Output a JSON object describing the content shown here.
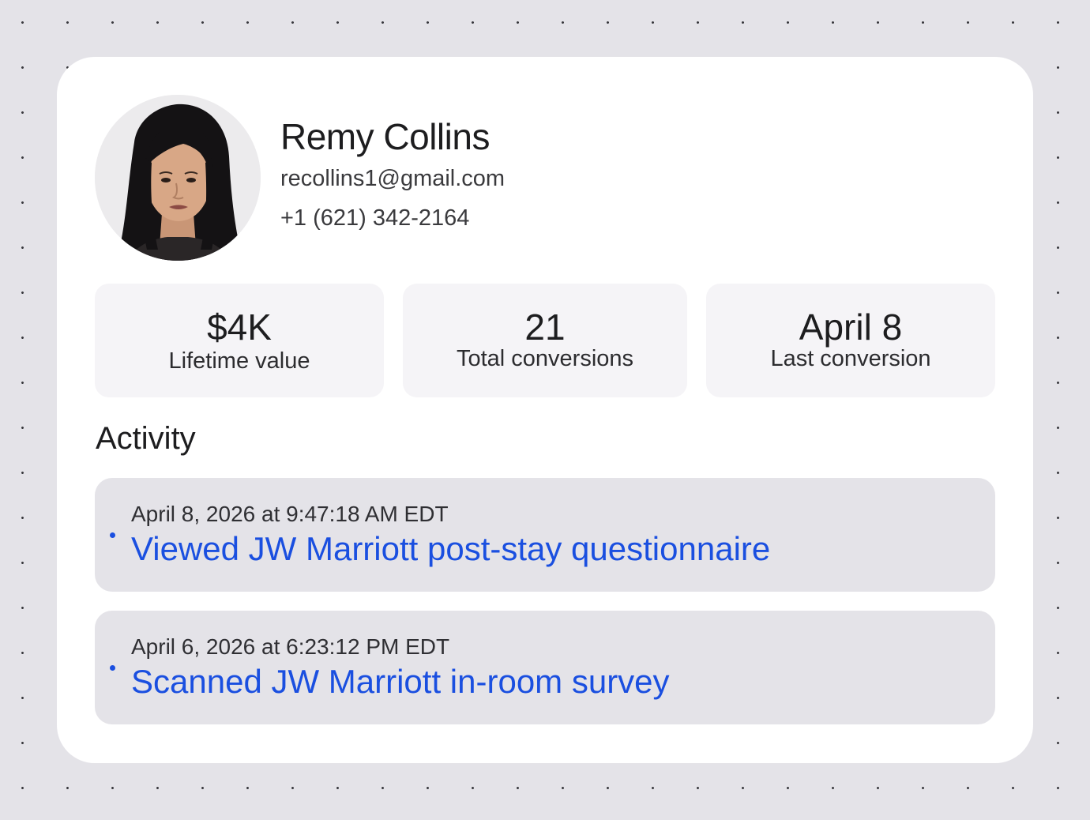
{
  "profile": {
    "name": "Remy Collins",
    "email": "recollins1@gmail.com",
    "phone": "+1 (621) 342-2164"
  },
  "stats": [
    {
      "value": "$4K",
      "label": "Lifetime value"
    },
    {
      "value": "21",
      "label": "Total conversions"
    },
    {
      "value": "April 8",
      "label": "Last conversion"
    }
  ],
  "activity": {
    "title": "Activity",
    "items": [
      {
        "timestamp": "April 8, 2026 at 9:47:18 AM EDT",
        "action": "Viewed JW Marriott post-stay questionnaire"
      },
      {
        "timestamp": "April 6, 2026 at 6:23:12 PM EDT",
        "action": "Scanned JW Marriott in-room survey"
      }
    ]
  },
  "colors": {
    "background": "#e4e3e8",
    "card": "#ffffff",
    "stat_tile": "#f5f4f7",
    "activity_tile": "#e4e3e8",
    "accent": "#1a4fe0",
    "text": "#1d1d1f"
  }
}
